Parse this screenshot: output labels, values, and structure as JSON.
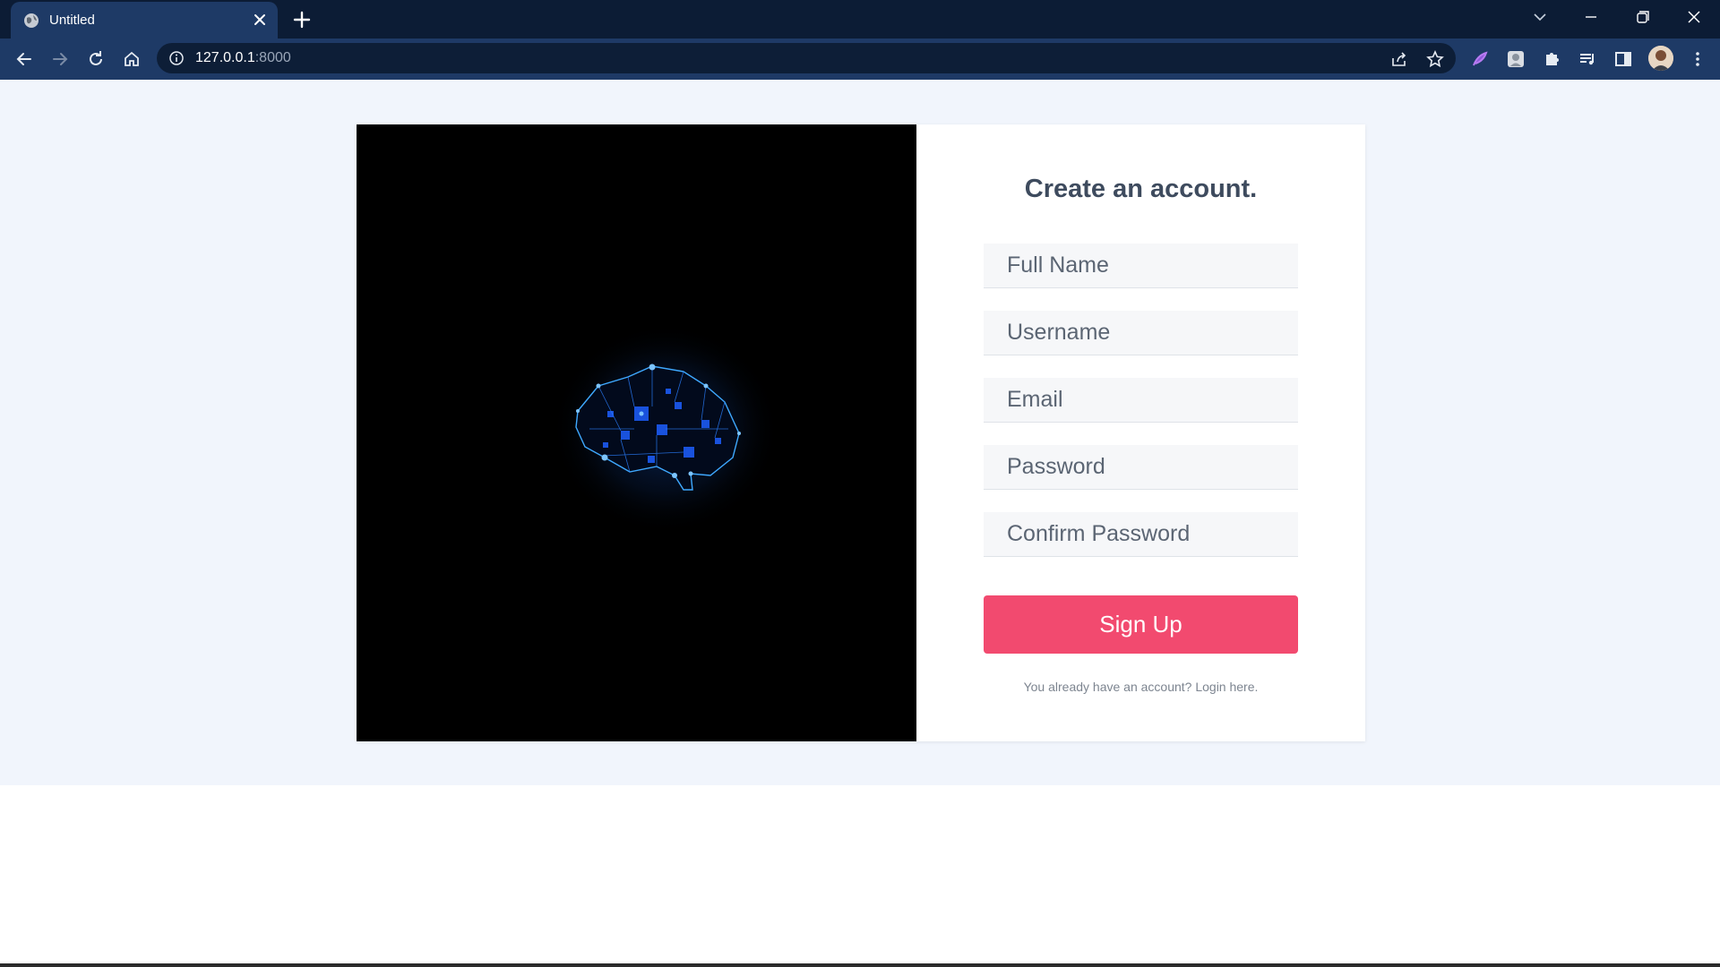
{
  "browser": {
    "tab_title": "Untitled",
    "url_host": "127.0.0.1",
    "url_port": ":8000"
  },
  "signup": {
    "heading_bold": "Create",
    "heading_rest": " an account.",
    "fields": {
      "full_name_placeholder": "Full Name",
      "username_placeholder": "Username",
      "email_placeholder": "Email",
      "password_placeholder": "Password",
      "confirm_password_placeholder": "Confirm Password"
    },
    "button_label": "Sign Up",
    "login_note": "You already have an account? Login here."
  },
  "colors": {
    "accent": "#f24a6f",
    "chrome_dark": "#0c1c35",
    "chrome_toolbar": "#1e3a66",
    "page_bg": "#f1f5fc"
  }
}
